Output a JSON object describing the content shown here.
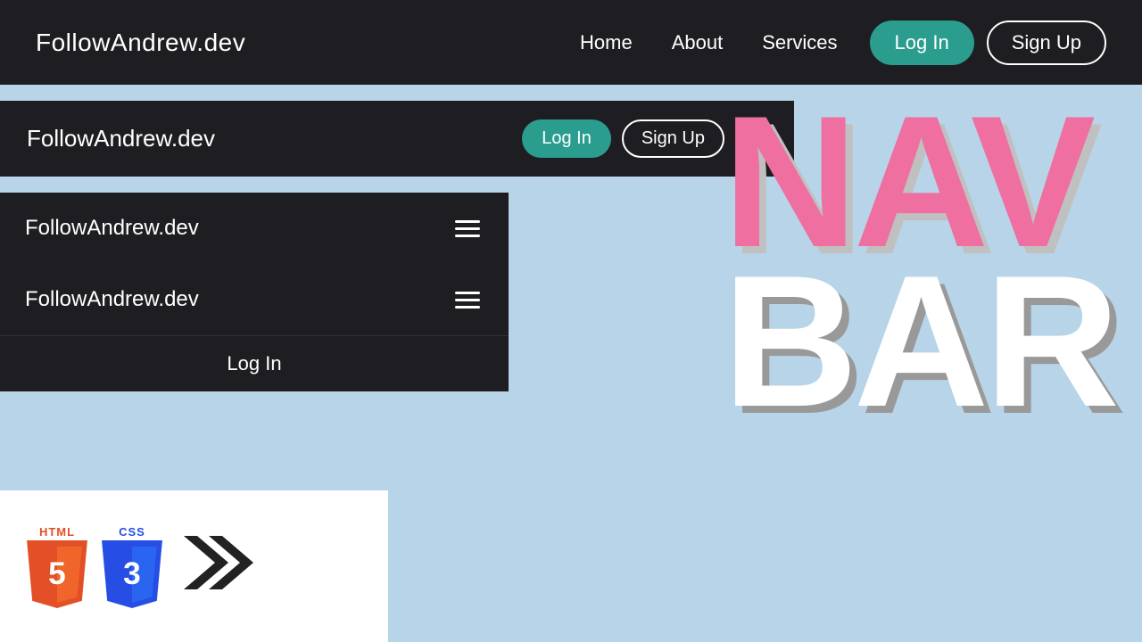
{
  "navbar_full": {
    "brand": "FollowAndrew.dev",
    "links": [
      {
        "label": "Home",
        "id": "home"
      },
      {
        "label": "About",
        "id": "about"
      },
      {
        "label": "Services",
        "id": "services"
      }
    ],
    "btn_login": "Log In",
    "btn_signup": "Sign Up"
  },
  "navbar_partial": {
    "brand": "FollowAndrew.dev",
    "btn_login": "Log In",
    "btn_signup": "Sign Up",
    "hamburger_label": "menu"
  },
  "navbar_small1": {
    "brand": "FollowAndrew.dev",
    "hamburger_label": "menu"
  },
  "navbar_small2": {
    "brand": "FollowAndrew.dev",
    "hamburger_label": "menu",
    "menu_item": "Log In"
  },
  "big_text": {
    "nav": "NAV",
    "bar": "BAR"
  },
  "html_badge": {
    "label": "HTML",
    "number": "5"
  },
  "css_badge": {
    "label": "CSS",
    "number": "3"
  },
  "arrow": "❯❯",
  "colors": {
    "navbar_bg": "#1e1e22",
    "teal": "#2a9d8f",
    "pink": "#ee6fa0",
    "white": "#ffffff"
  }
}
